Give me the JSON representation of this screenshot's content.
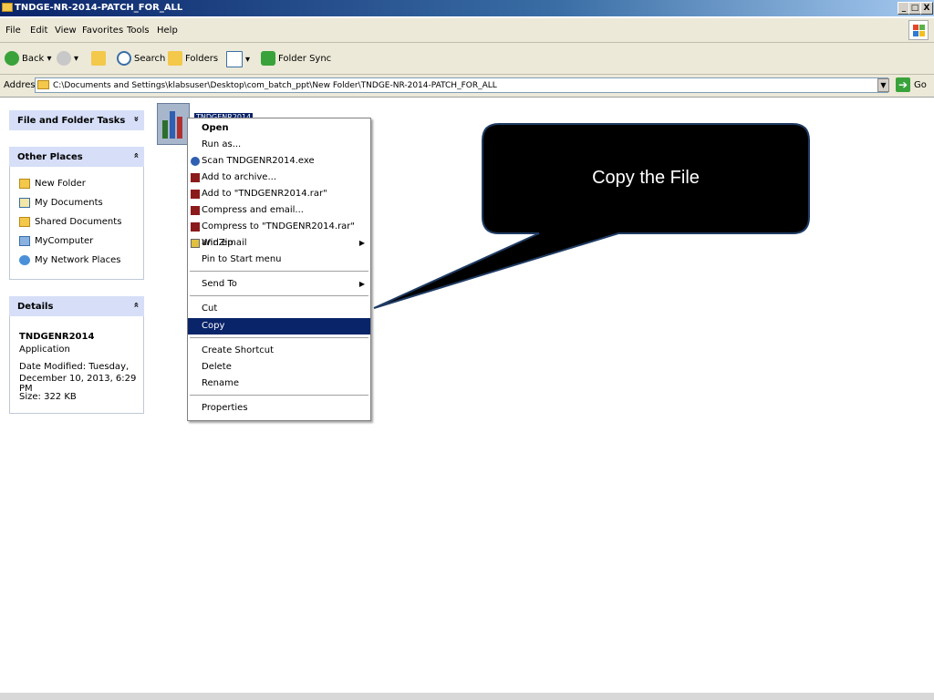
{
  "window": {
    "title": "TNDGE-NR-2014-PATCH_FOR_ALL",
    "controls": [
      "_",
      "□",
      "X"
    ]
  },
  "menu": [
    "File",
    "Edit",
    "View",
    "Favorites",
    "Tools",
    "Help"
  ],
  "toolbar": {
    "back": "Back",
    "search": "Search",
    "folders": "Folders",
    "folder_sync": "Folder Sync"
  },
  "address": {
    "label": "Address",
    "value": "C:\\Documents and Settings\\klabsuser\\Desktop\\com_batch_ppt\\New Folder\\TNDGE-NR-2014-PATCH_FOR_ALL",
    "go": "Go"
  },
  "sidebar": {
    "tasks": {
      "title": "File and Folder Tasks",
      "chevron": "»"
    },
    "other_places": {
      "title": "Other Places",
      "chevron": "«",
      "items": [
        "New Folder",
        "My Documents",
        "Shared Documents",
        "MyComputer",
        "My Network Places"
      ]
    },
    "details": {
      "title": "Details",
      "chevron": "«",
      "name": "TNDGENR2014",
      "type": "Application",
      "date_line1": "Date Modified: Tuesday,",
      "date_line2": "December 10, 2013, 6:29 PM",
      "size": "Size: 322 KB"
    }
  },
  "file": {
    "label": "TNDGENR2014"
  },
  "context_menu": {
    "items": [
      "Open",
      "Run as...",
      "Scan TNDGENR2014.exe",
      "Add to archive...",
      "Add to \"TNDGENR2014.rar\"",
      "Compress and email...",
      "Compress to \"TNDGENR2014.rar\" and email",
      "WinZip",
      "Pin to Start menu",
      "Send To",
      "Cut",
      "Copy",
      "Create Shortcut",
      "Delete",
      "Rename",
      "Properties"
    ],
    "selected": "Copy",
    "submenu_arrow": "▶"
  },
  "callout": {
    "text": "Copy the File",
    "fill": "#000000",
    "border": "#1f3b63"
  },
  "colors": {
    "title_bar": "#0a246a",
    "selection": "#0a246a",
    "panel_head": "#d6dff7"
  }
}
